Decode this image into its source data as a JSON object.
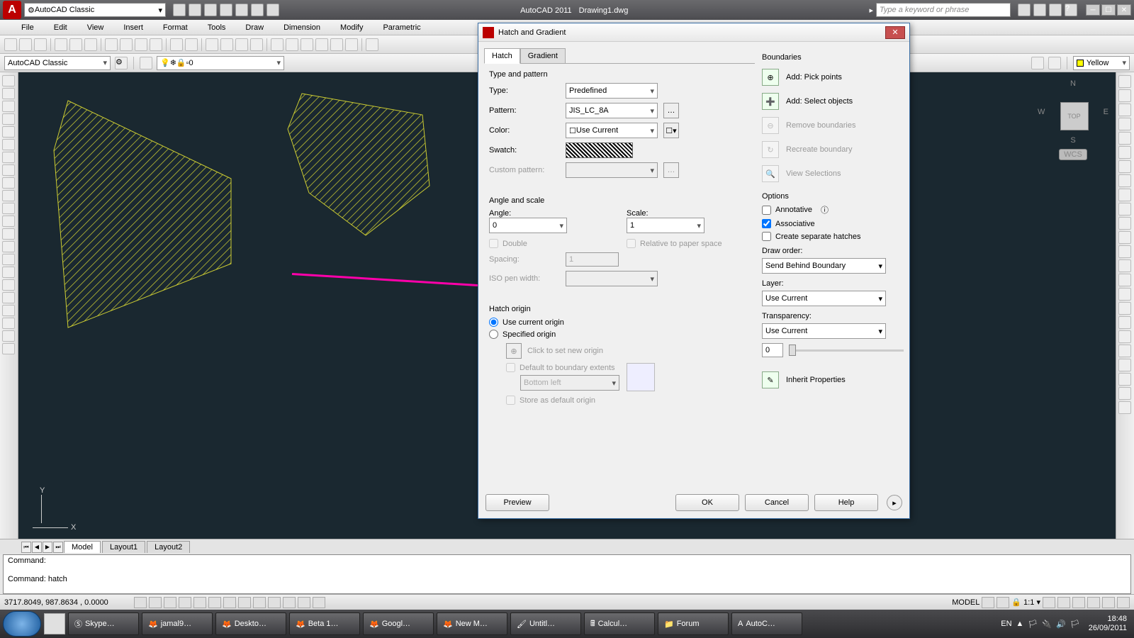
{
  "title": {
    "app": "AutoCAD 2011",
    "file": "Drawing1.dwg",
    "workspace": "AutoCAD Classic",
    "search_placeholder": "Type a keyword or phrase"
  },
  "menu": [
    "File",
    "Edit",
    "View",
    "Insert",
    "Format",
    "Tools",
    "Draw",
    "Dimension",
    "Modify",
    "Parametric"
  ],
  "layer_toolbar": {
    "workspace": "AutoCAD Classic",
    "layer": "0",
    "color": "Yellow"
  },
  "tabs": [
    "Model",
    "Layout1",
    "Layout2"
  ],
  "cmd": {
    "line1": "Command:",
    "line2": "Command:  hatch"
  },
  "status": {
    "coords": "3717.8049, 987.8634 , 0.0000",
    "model": "MODEL",
    "scale": "1:1"
  },
  "viewcube": {
    "top": "TOP",
    "n": "N",
    "s": "S",
    "e": "E",
    "w": "W",
    "wcs": "WCS"
  },
  "ucs": {
    "y": "Y",
    "x": "X"
  },
  "dialog": {
    "title": "Hatch and Gradient",
    "tabs": {
      "hatch": "Hatch",
      "gradient": "Gradient"
    },
    "type_pattern": {
      "title": "Type and pattern",
      "type_label": "Type:",
      "type_val": "Predefined",
      "pattern_label": "Pattern:",
      "pattern_val": "JIS_LC_8A",
      "color_label": "Color:",
      "color_val": "Use Current",
      "swatch_label": "Swatch:",
      "custom_label": "Custom pattern:"
    },
    "angle_scale": {
      "title": "Angle and scale",
      "angle_label": "Angle:",
      "angle_val": "0",
      "scale_label": "Scale:",
      "scale_val": "1",
      "double": "Double",
      "rel_paper": "Relative to paper space",
      "spacing_label": "Spacing:",
      "spacing_val": "1",
      "iso_label": "ISO pen width:"
    },
    "origin": {
      "title": "Hatch origin",
      "use_current": "Use current origin",
      "specified": "Specified origin",
      "click_new": "Click to set new origin",
      "default_extents": "Default to boundary extents",
      "bottom_left": "Bottom left",
      "store_default": "Store as default origin"
    },
    "boundaries": {
      "title": "Boundaries",
      "pick": "Add: Pick points",
      "select": "Add: Select objects",
      "remove": "Remove boundaries",
      "recreate": "Recreate boundary",
      "view": "View Selections"
    },
    "options": {
      "title": "Options",
      "annotative": "Annotative",
      "associative": "Associative",
      "separate": "Create separate hatches",
      "draw_order_label": "Draw order:",
      "draw_order_val": "Send Behind Boundary",
      "layer_label": "Layer:",
      "layer_val": "Use Current",
      "trans_label": "Transparency:",
      "trans_val": "Use Current",
      "trans_num": "0"
    },
    "inherit": "Inherit Properties",
    "buttons": {
      "preview": "Preview",
      "ok": "OK",
      "cancel": "Cancel",
      "help": "Help"
    }
  },
  "taskbar": {
    "items": [
      "Skype…",
      "jamal9…",
      "Deskto…",
      "Beta 1…",
      "Googl…",
      "New M…",
      "Untitl…",
      "Calcul…",
      "Forum",
      "AutoC…"
    ],
    "lang": "EN",
    "time": "18:48",
    "date": "26/09/2011"
  }
}
